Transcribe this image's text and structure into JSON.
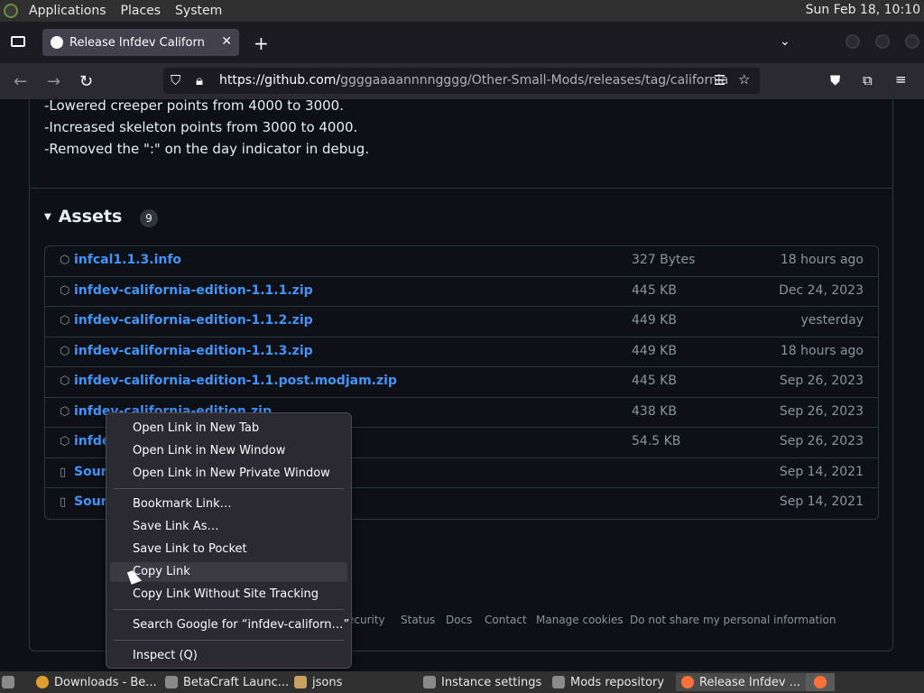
{
  "desktop": {
    "menu_applications": "Applications",
    "menu_places": "Places",
    "menu_system": "System",
    "clock": "Sun Feb 18, 10:10"
  },
  "browser": {
    "tab_title": "Release Infdev California Ed",
    "url_host": "https://github.com/",
    "url_path": "ggggaaaannnngggg/Other-Small-Mods/releases/tag/california"
  },
  "release_notes": [
    "-Lowered creeper points from 4000 to 3000.",
    "-Increased skeleton points from 3000 to 4000.",
    "-Removed the \":\" on the day indicator in debug."
  ],
  "assets": {
    "heading": "Assets",
    "count": "9",
    "rows": [
      {
        "name": "infcal1.1.3.info",
        "size": "327 Bytes",
        "date": "18 hours ago",
        "icon": "package-icon"
      },
      {
        "name": "infdev-california-edition-1.1.1.zip",
        "size": "445 KB",
        "date": "Dec 24, 2023",
        "icon": "package-icon"
      },
      {
        "name": "infdev-california-edition-1.1.2.zip",
        "size": "449 KB",
        "date": "yesterday",
        "icon": "package-icon"
      },
      {
        "name": "infdev-california-edition-1.1.3.zip",
        "size": "449 KB",
        "date": "18 hours ago",
        "icon": "package-icon"
      },
      {
        "name": "infdev-california-edition-1.1.post.modjam.zip",
        "size": "445 KB",
        "date": "Sep 26, 2023",
        "icon": "package-icon"
      },
      {
        "name": "infdev-california-edition.zip",
        "size": "438 KB",
        "date": "Sep 26, 2023",
        "icon": "package-icon"
      },
      {
        "name": "infde",
        "size": "54.5 KB",
        "date": "Sep 26, 2023",
        "icon": "package-icon"
      },
      {
        "name": "Sourc",
        "size": "",
        "date": "Sep 14, 2021",
        "icon": "zip-icon"
      },
      {
        "name": "Sourc",
        "size": "",
        "date": "Sep 14, 2021",
        "icon": "zip-icon"
      }
    ]
  },
  "footer": [
    "ecurity",
    "Status",
    "Docs",
    "Contact",
    "Manage cookies",
    "Do not share my personal information"
  ],
  "context_menu": {
    "open_new_tab": "Open Link in New Tab",
    "open_new_window": "Open Link in New Window",
    "open_private": "Open Link in New Private Window",
    "bookmark": "Bookmark Link…",
    "save_as": "Save Link As…",
    "save_pocket": "Save Link to Pocket",
    "copy_link": "Copy Link",
    "copy_no_tracking": "Copy Link Without Site Tracking",
    "search_google": "Search Google for “infdev-californ…”",
    "inspect": "Inspect (Q)"
  },
  "taskbar": [
    {
      "label": "Downloads - Be...",
      "color": "#e0a030"
    },
    {
      "label": "BetaCraft Launc...",
      "color": "#8a8a8a"
    },
    {
      "label": "jsons",
      "color": "#c8a060"
    },
    {
      "label": "Instance settings",
      "color": "#8a8a8a"
    },
    {
      "label": "Mods repository",
      "color": "#8a8a8a"
    },
    {
      "label": "Release Infdev ...",
      "color": "#ff7139"
    }
  ]
}
